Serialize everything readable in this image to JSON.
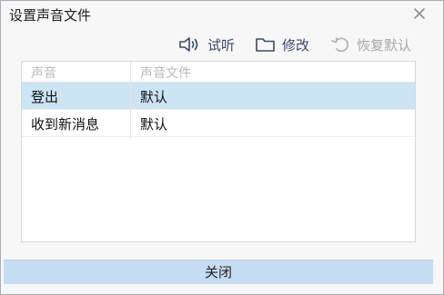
{
  "window": {
    "title": "设置声音文件"
  },
  "toolbar": {
    "test_label": "试听",
    "test_icon": "speaker-icon",
    "edit_label": "修改",
    "edit_icon": "folder-icon",
    "restore_label": "恢复默认",
    "restore_icon": "undo-icon",
    "restore_enabled": false
  },
  "table": {
    "columns": [
      "声音",
      "声音文件"
    ],
    "rows": [
      {
        "sound": "登出",
        "file": "默认",
        "selected": true
      },
      {
        "sound": "收到新消息",
        "file": "默认",
        "selected": false
      }
    ]
  },
  "footer": {
    "close_label": "关闭"
  },
  "colors": {
    "selected_row": "#cde4f4",
    "footer_button": "#c6dcf2",
    "toolbar_text": "#3a4a6b",
    "disabled_text": "#a6a9ad"
  }
}
